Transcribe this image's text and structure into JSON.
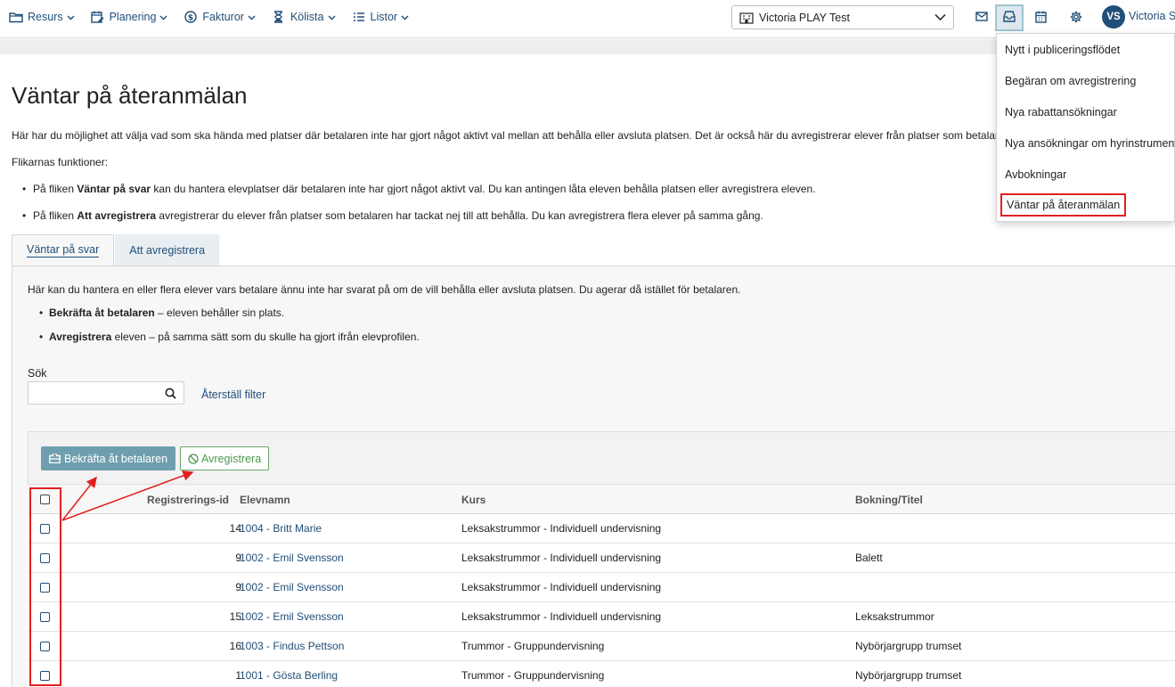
{
  "nav": {
    "items": [
      {
        "label": "Resurs",
        "icon": "folder-icon"
      },
      {
        "label": "Planering",
        "icon": "calendar-edit-icon"
      },
      {
        "label": "Fakturor",
        "icon": "dollar-circle-icon"
      },
      {
        "label": "Kölista",
        "icon": "hourglass-icon"
      },
      {
        "label": "Listor",
        "icon": "list-icon"
      }
    ],
    "organization": "Victoria PLAY Test",
    "user_initials": "VS",
    "user_name": "Victoria S"
  },
  "dropdown": {
    "items": [
      "Nytt i publiceringsflödet",
      "Begäran om avregistrering",
      "Nya rabattansökningar",
      "Nya ansökningar om hyrinstrument",
      "Avbokningar",
      "Väntar på återanmälan"
    ]
  },
  "page": {
    "title": "Väntar på återanmälan",
    "intro": "Här har du möjlighet att välja vad som ska hända med platser där betalaren inte har gjort något aktivt val mellan att behålla eller avsluta platsen. Det är också här du avregistrerar elever från platser som betalaren",
    "functions_label": "Flikarnas funktioner:",
    "bullet1_prefix": "På fliken ",
    "bullet1_bold": "Väntar på svar",
    "bullet1_rest": " kan du hantera elevplatser där betalaren inte har gjort något aktivt val. Du kan antingen låta eleven behålla platsen eller avregistrera eleven.",
    "bullet2_prefix": "På fliken ",
    "bullet2_bold": "Att avregistrera",
    "bullet2_rest": " avregistrerar du elever från platser som betalaren har tackat nej till att behålla. Du kan avregistrera flera elever på samma gång."
  },
  "tabs": {
    "waiting": "Väntar på svar",
    "to_unregister": "Att avregistrera"
  },
  "panel": {
    "description": "Här kan du hantera en eller flera elever vars betalare ännu inte har svarat på om de vill behålla eller avsluta platsen. Du agerar då istället för betalaren.",
    "pb1_bold": "Bekräfta åt betalaren",
    "pb1_rest": " – eleven behåller sin plats.",
    "pb2_bold": "Avregistrera",
    "pb2_rest": " eleven – på samma sätt som du skulle ha gjort ifrån elevprofilen.",
    "search_label": "Sök",
    "search_value": "",
    "reset_filter": "Återställ filter",
    "confirm_button": "Bekräfta åt betalaren",
    "unregister_button": "Avregistrera"
  },
  "table": {
    "headers": {
      "reg_id": "Registrerings-id",
      "student": "Elevnamn",
      "course": "Kurs",
      "booking": "Bokning/Titel"
    },
    "rows": [
      {
        "reg_id": "14",
        "student": "1004 - Britt Marie",
        "course": "Leksakstrummor - Individuell undervisning",
        "booking": ""
      },
      {
        "reg_id": "9",
        "student": "1002 - Emil Svensson",
        "course": "Leksakstrummor - Individuell undervisning",
        "booking": "Balett"
      },
      {
        "reg_id": "9",
        "student": "1002 - Emil Svensson",
        "course": "Leksakstrummor - Individuell undervisning",
        "booking": ""
      },
      {
        "reg_id": "15",
        "student": "1002 - Emil Svensson",
        "course": "Leksakstrummor - Individuell undervisning",
        "booking": "Leksakstrummor"
      },
      {
        "reg_id": "16",
        "student": "1003 - Findus Pettson",
        "course": "Trummor - Gruppundervisning",
        "booking": "Nybörjargrupp trumset"
      },
      {
        "reg_id": "1",
        "student": "1001 - Gösta Berling",
        "course": "Trummor - Gruppundervisning",
        "booking": "Nybörjargrupp trumset"
      }
    ]
  },
  "colors": {
    "link": "#1f4e79",
    "confirm_button": "#6f9fae",
    "unregister_button": "#4a9a4a",
    "annotation": "#e02020"
  }
}
